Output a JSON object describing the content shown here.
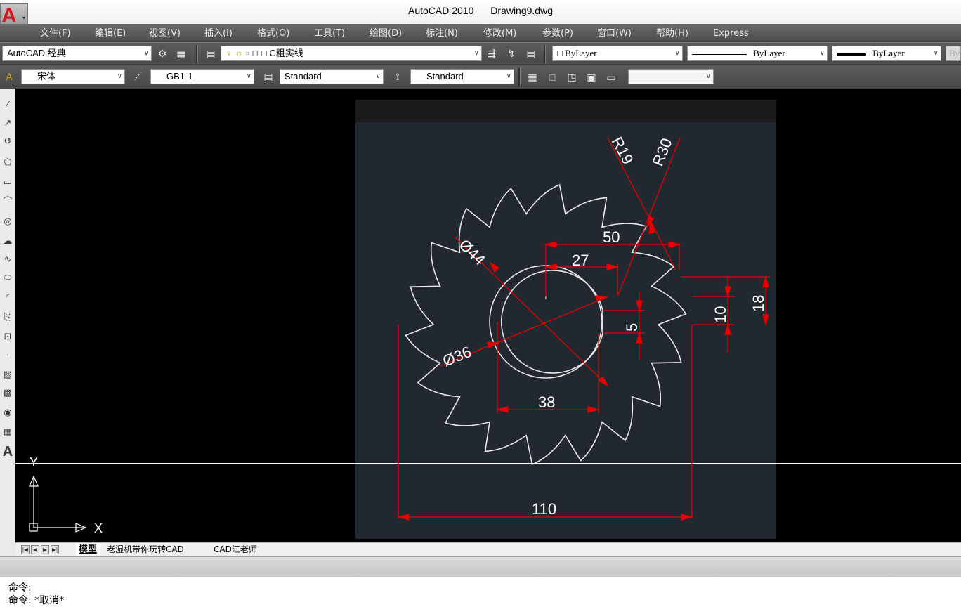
{
  "window": {
    "app": "AutoCAD 2010",
    "file": "Drawing9.dwg"
  },
  "menu": [
    {
      "label": "文件(F)"
    },
    {
      "label": "编辑(E)"
    },
    {
      "label": "视图(V)"
    },
    {
      "label": "插入(I)"
    },
    {
      "label": "格式(O)"
    },
    {
      "label": "工具(T)"
    },
    {
      "label": "绘图(D)"
    },
    {
      "label": "标注(N)"
    },
    {
      "label": "修改(M)"
    },
    {
      "label": "参数(P)"
    },
    {
      "label": "窗口(W)"
    },
    {
      "label": "帮助(H)"
    },
    {
      "label": "Express"
    }
  ],
  "toolbar1": {
    "workspace": "AutoCAD 经典",
    "layer": "C粗实线",
    "color": "ByLayer",
    "linetype": "ByLayer",
    "lineweight": "ByLayer",
    "plotstyle": "By"
  },
  "toolbar2": {
    "text_font": "宋体",
    "dim_font": "GB1-1",
    "text_style": "Standard",
    "dim_style": "Standard",
    "empty_combo": ""
  },
  "drawing": {
    "ucs_y": "Y",
    "ucs_x": "X",
    "dimensions": {
      "d110": "110",
      "d50": "50",
      "d27": "27",
      "d38": "38",
      "d5": "5",
      "d10": "10",
      "d18": "18",
      "dia44": "Ø44",
      "dia36": "Ø36",
      "r19": "R19",
      "r30": "R30"
    }
  },
  "tabs": {
    "model": "模型",
    "layout1": "老湿机带你玩转CAD",
    "layout2": "CAD江老师"
  },
  "command": {
    "line1": "命令:",
    "line2": "命令: *取消*"
  },
  "colors": {
    "canvas": "#000000",
    "paper": "#212830",
    "dimension": "#e60000",
    "geometry": "#ffffff"
  }
}
